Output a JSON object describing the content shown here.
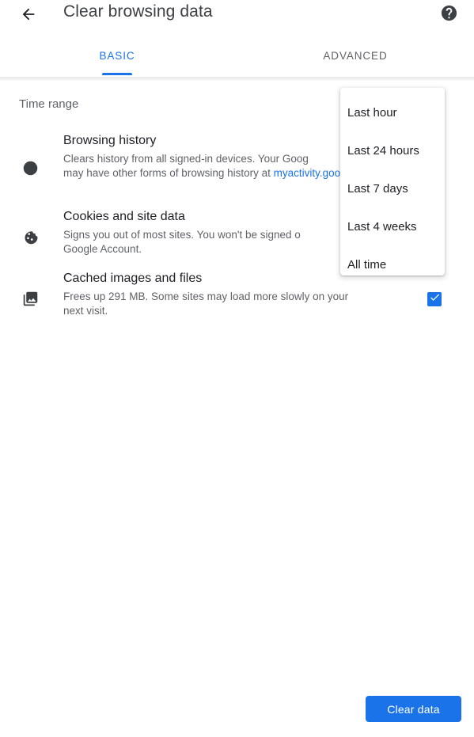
{
  "header": {
    "back_icon": "arrow-back-icon",
    "title": "Clear browsing data",
    "help_icon": "help-circle-icon"
  },
  "tabs": [
    {
      "label": "BASIC",
      "active": true
    },
    {
      "label": "ADVANCED",
      "active": false
    }
  ],
  "body": {
    "time_range_label": "Time range",
    "rows": [
      {
        "icon": "clock-icon",
        "title": "Browsing history",
        "desc_part1": "Clears history from all signed-in devices. Your Goog",
        "desc_part2": "may have other forms of browsing history at ",
        "link": "myactivity.google.com",
        "desc_end": "."
      },
      {
        "icon": "cookie-icon",
        "title": "Cookies and site data",
        "desc_part1": "Signs you out of most sites. You won't be signed o",
        "desc_part2": "Google Account."
      },
      {
        "icon": "photo-library-icon",
        "title": "Cached images and files",
        "desc_part1": "Frees up 291 MB. Some sites may load more slowly on your",
        "desc_part2": "next visit.",
        "checked": true
      }
    ]
  },
  "dropdown": {
    "items": [
      {
        "label": "Last hour"
      },
      {
        "label": "Last 24 hours"
      },
      {
        "label": "Last 7 days"
      },
      {
        "label": "Last 4 weeks"
      },
      {
        "label": "All time"
      }
    ]
  },
  "footer": {
    "clear_button_label": "Clear data"
  },
  "colors": {
    "accent": "#1a73e8",
    "title_text": "#3c4043",
    "body_text": "#202124",
    "secondary_text": "#5f6368",
    "background": "#ffffff"
  }
}
